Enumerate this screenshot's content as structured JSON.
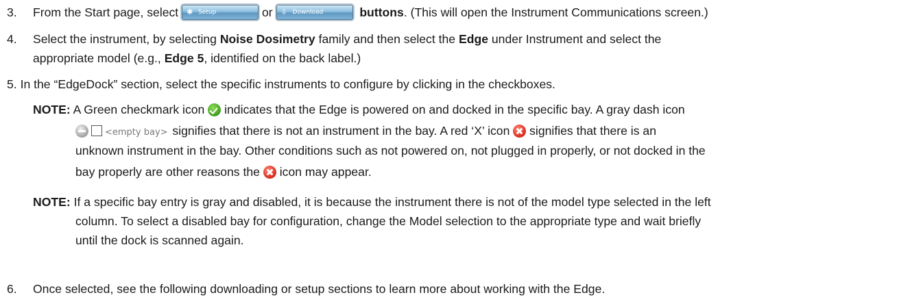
{
  "steps": [
    {
      "number": "3.",
      "before_buttons": "From the Start page, select ",
      "or": " or ",
      "buttons_word": "buttons",
      "after_buttons": ". (This will open the Instrument Communications screen.)"
    },
    {
      "number": "4.",
      "line1_a": "Select the instrument, by selecting ",
      "noise_dosimetry": "Noise Dosimetry",
      "line1_b": " family and then select the ",
      "edge": "Edge",
      "line1_c": " under Instrument and select the",
      "line2_a": "appropriate model (e.g., ",
      "edge5": "Edge 5",
      "line2_b": ", identified on the back label.)"
    },
    {
      "number": "5.",
      "text": "In the “EdgeDock” section, select the specific instruments to configure by clicking in the checkboxes."
    },
    {
      "number": "6.",
      "text": "Once selected, see the following downloading or setup sections to learn more about working with the Edge."
    }
  ],
  "notes": [
    {
      "label": "NOTE:",
      "l1_a": " A Green checkmark icon ",
      "l1_b": " indicates that the Edge is powered on and docked in the specific bay. A gray dash icon",
      "l2_a": " signifies that there is not an instrument in the bay. A red ‘X’ icon ",
      "l2_b": " signifies that there is an",
      "l3": "unknown instrument in the bay. Other conditions such as not powered on, not plugged in properly, or not docked in the",
      "l4_a": "bay properly are other reasons the ",
      "l4_b": " icon may appear."
    },
    {
      "label": "NOTE:",
      "l1": " If a specific bay entry is gray and disabled, it is because the instrument there is not of the model type selected in the left",
      "l2": "column. To select a disabled bay for configuration, change the Model selection to the appropriate type and wait briefly",
      "l3": "until the dock is scanned again."
    }
  ],
  "ui_buttons": {
    "setup": {
      "label": "Setup",
      "icon": "gear-icon",
      "glyph": "✱"
    },
    "download": {
      "label": "Download",
      "icon": "download-arrow-icon",
      "glyph": "⇩"
    }
  },
  "empty_bay_text": "<empty bay>",
  "colors": {
    "check_green": "#3f9b1e",
    "x_red": "#d9281a",
    "dash_gray": "#9a9a9a",
    "button_blue": "#5f98c2"
  }
}
